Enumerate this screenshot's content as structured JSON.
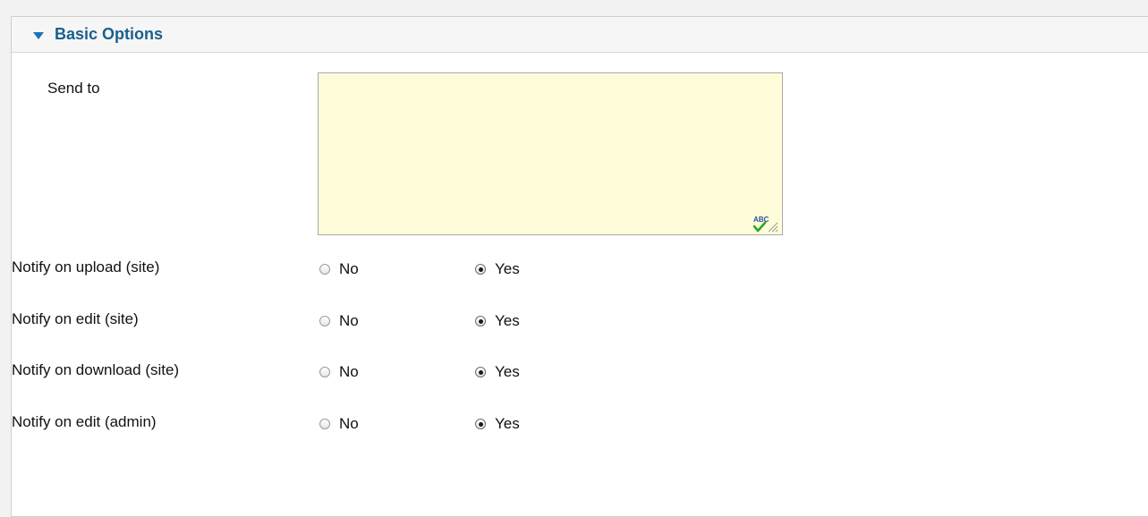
{
  "panel": {
    "title": "Basic Options"
  },
  "send_to": {
    "label": "Send to",
    "value": ""
  },
  "options": [
    {
      "label": "Notify on upload (site)",
      "no_label": "No",
      "yes_label": "Yes",
      "selected": "Yes"
    },
    {
      "label": "Notify on edit (site)",
      "no_label": "No",
      "yes_label": "Yes",
      "selected": "Yes"
    },
    {
      "label": "Notify on download (site)",
      "no_label": "No",
      "yes_label": "Yes",
      "selected": "Yes"
    },
    {
      "label": "Notify on edit (admin)",
      "no_label": "No",
      "yes_label": "Yes",
      "selected": "Yes"
    }
  ],
  "icons": {
    "collapse": "triangle-down-icon",
    "spellcheck": "spellcheck-icon"
  },
  "colors": {
    "title": "#1a5f8d",
    "arrow": "#1b73b3",
    "textarea_bg": "#fefcd9"
  }
}
